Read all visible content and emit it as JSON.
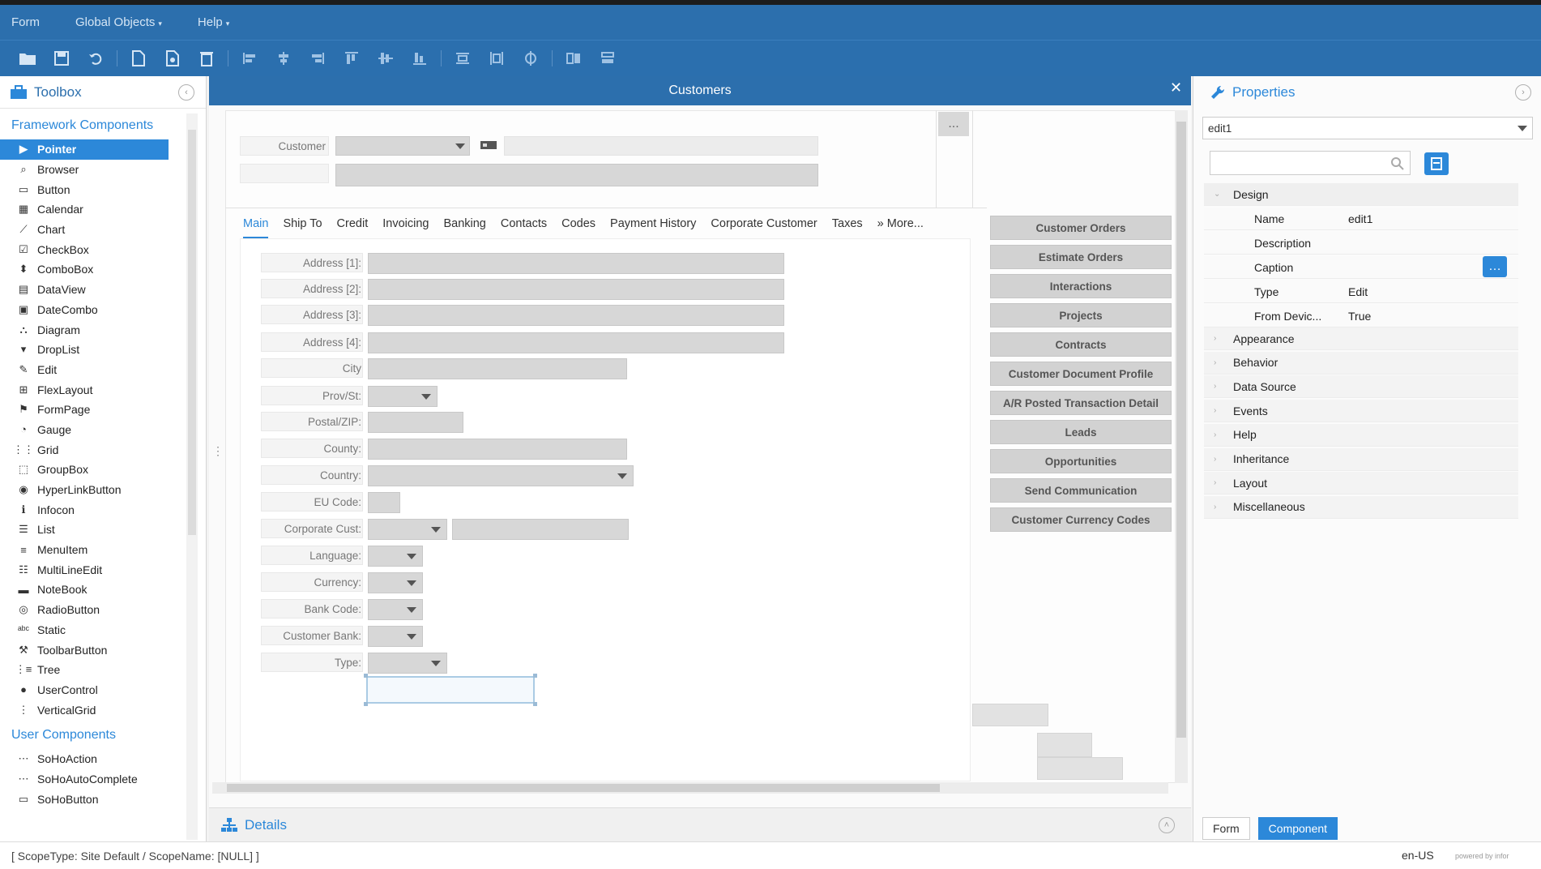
{
  "menubar": {
    "items": [
      {
        "label": "Form",
        "dropdown": false
      },
      {
        "label": "Global Objects",
        "dropdown": true
      },
      {
        "label": "Help",
        "dropdown": true
      }
    ]
  },
  "toolbar": {
    "buttons": [
      "open-folder-icon",
      "save-icon",
      "undo-icon",
      "new-doc-icon",
      "save-as-icon",
      "delete-icon",
      "align-left-icon",
      "align-center-icon",
      "align-right-icon",
      "align-top-icon",
      "align-middle-icon",
      "align-bottom-icon",
      "distribute-h-icon",
      "distribute-v-icon",
      "center-icon",
      "same-width-icon",
      "same-height-icon"
    ]
  },
  "toolbox": {
    "title": "Toolbox",
    "framework_section": "Framework Components",
    "framework_items": [
      "Pointer",
      "Browser",
      "Button",
      "Calendar",
      "Chart",
      "CheckBox",
      "ComboBox",
      "DataView",
      "DateCombo",
      "Diagram",
      "DropList",
      "Edit",
      "FlexLayout",
      "FormPage",
      "Gauge",
      "Grid",
      "GroupBox",
      "HyperLinkButton",
      "Infocon",
      "List",
      "MenuItem",
      "MultiLineEdit",
      "NoteBook",
      "RadioButton",
      "Static",
      "ToolbarButton",
      "Tree",
      "UserControl",
      "VerticalGrid"
    ],
    "selected_item": "Pointer",
    "user_section": "User Components",
    "user_items": [
      "SoHoAction",
      "SoHoAutoComplete",
      "SoHoButton"
    ]
  },
  "designer": {
    "title": "Customers",
    "customer_label": "Customer",
    "tabs": [
      "Main",
      "Ship To",
      "Credit",
      "Invoicing",
      "Banking",
      "Contacts",
      "Codes",
      "Payment History",
      "Corporate Customer",
      "Taxes",
      "» More..."
    ],
    "active_tab": "Main",
    "fields": [
      {
        "label": "Address [1]:"
      },
      {
        "label": "Address [2]:"
      },
      {
        "label": "Address [3]:"
      },
      {
        "label": "Address [4]:"
      },
      {
        "label": "City"
      },
      {
        "label": "Prov/St:"
      },
      {
        "label": "Postal/ZIP:"
      },
      {
        "label": "County:"
      },
      {
        "label": "Country:"
      },
      {
        "label": "EU Code:"
      },
      {
        "label": "Corporate Cust:"
      },
      {
        "label": "Language:"
      },
      {
        "label": "Currency:"
      },
      {
        "label": "Bank Code:"
      },
      {
        "label": "Customer Bank:"
      },
      {
        "label": "Type:"
      }
    ],
    "side_buttons": [
      "Customer Orders",
      "Estimate Orders",
      "Interactions",
      "Projects",
      "Contracts",
      "Customer Document Profile",
      "A/R Posted Transaction Detail",
      "Leads",
      "Opportunities",
      "Send Communication",
      "Customer Currency Codes"
    ],
    "ellipsis": "...",
    "details_label": "Details"
  },
  "properties": {
    "title": "Properties",
    "selected_object": "edit1",
    "design_group": "Design",
    "design_rows": [
      {
        "key": "Name",
        "value": "edit1"
      },
      {
        "key": "Description",
        "value": ""
      },
      {
        "key": "Caption",
        "value": ""
      },
      {
        "key": "Type",
        "value": "Edit"
      },
      {
        "key": "From Devic...",
        "value": "True"
      }
    ],
    "groups": [
      "Appearance",
      "Behavior",
      "Data Source",
      "Events",
      "Help",
      "Inheritance",
      "Layout",
      "Miscellaneous"
    ],
    "bottom_tabs": [
      "Form",
      "Component"
    ],
    "active_bottom_tab": "Component"
  },
  "status": {
    "scope": "[ ScopeType: Site Default / ScopeName: [NULL] ]",
    "locale": "en-US",
    "powered": "powered by infor"
  }
}
